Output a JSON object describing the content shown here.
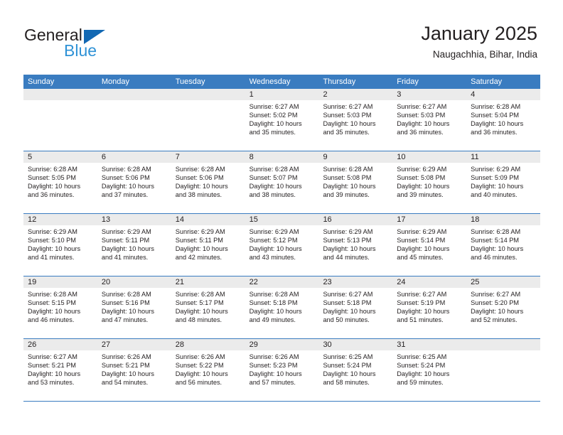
{
  "brand": {
    "name_part1": "General",
    "name_part2": "Blue",
    "accent_color": "#2f92d6",
    "triangle_color": "#1268b3"
  },
  "header": {
    "title": "January 2025",
    "subtitle": "Naugachhia, Bihar, India"
  },
  "calendar": {
    "header_bg": "#3a7cc0",
    "datecell_bg": "#ebebeb",
    "weekdays": [
      "Sunday",
      "Monday",
      "Tuesday",
      "Wednesday",
      "Thursday",
      "Friday",
      "Saturday"
    ],
    "weeks": [
      [
        {
          "day": "",
          "empty": true
        },
        {
          "day": "",
          "empty": true
        },
        {
          "day": "",
          "empty": true
        },
        {
          "day": "1",
          "sunrise": "Sunrise: 6:27 AM",
          "sunset": "Sunset: 5:02 PM",
          "daylight_line1": "Daylight: 10 hours",
          "daylight_line2": "and 35 minutes."
        },
        {
          "day": "2",
          "sunrise": "Sunrise: 6:27 AM",
          "sunset": "Sunset: 5:03 PM",
          "daylight_line1": "Daylight: 10 hours",
          "daylight_line2": "and 35 minutes."
        },
        {
          "day": "3",
          "sunrise": "Sunrise: 6:27 AM",
          "sunset": "Sunset: 5:03 PM",
          "daylight_line1": "Daylight: 10 hours",
          "daylight_line2": "and 36 minutes."
        },
        {
          "day": "4",
          "sunrise": "Sunrise: 6:28 AM",
          "sunset": "Sunset: 5:04 PM",
          "daylight_line1": "Daylight: 10 hours",
          "daylight_line2": "and 36 minutes."
        }
      ],
      [
        {
          "day": "5",
          "sunrise": "Sunrise: 6:28 AM",
          "sunset": "Sunset: 5:05 PM",
          "daylight_line1": "Daylight: 10 hours",
          "daylight_line2": "and 36 minutes."
        },
        {
          "day": "6",
          "sunrise": "Sunrise: 6:28 AM",
          "sunset": "Sunset: 5:06 PM",
          "daylight_line1": "Daylight: 10 hours",
          "daylight_line2": "and 37 minutes."
        },
        {
          "day": "7",
          "sunrise": "Sunrise: 6:28 AM",
          "sunset": "Sunset: 5:06 PM",
          "daylight_line1": "Daylight: 10 hours",
          "daylight_line2": "and 38 minutes."
        },
        {
          "day": "8",
          "sunrise": "Sunrise: 6:28 AM",
          "sunset": "Sunset: 5:07 PM",
          "daylight_line1": "Daylight: 10 hours",
          "daylight_line2": "and 38 minutes."
        },
        {
          "day": "9",
          "sunrise": "Sunrise: 6:28 AM",
          "sunset": "Sunset: 5:08 PM",
          "daylight_line1": "Daylight: 10 hours",
          "daylight_line2": "and 39 minutes."
        },
        {
          "day": "10",
          "sunrise": "Sunrise: 6:29 AM",
          "sunset": "Sunset: 5:08 PM",
          "daylight_line1": "Daylight: 10 hours",
          "daylight_line2": "and 39 minutes."
        },
        {
          "day": "11",
          "sunrise": "Sunrise: 6:29 AM",
          "sunset": "Sunset: 5:09 PM",
          "daylight_line1": "Daylight: 10 hours",
          "daylight_line2": "and 40 minutes."
        }
      ],
      [
        {
          "day": "12",
          "sunrise": "Sunrise: 6:29 AM",
          "sunset": "Sunset: 5:10 PM",
          "daylight_line1": "Daylight: 10 hours",
          "daylight_line2": "and 41 minutes."
        },
        {
          "day": "13",
          "sunrise": "Sunrise: 6:29 AM",
          "sunset": "Sunset: 5:11 PM",
          "daylight_line1": "Daylight: 10 hours",
          "daylight_line2": "and 41 minutes."
        },
        {
          "day": "14",
          "sunrise": "Sunrise: 6:29 AM",
          "sunset": "Sunset: 5:11 PM",
          "daylight_line1": "Daylight: 10 hours",
          "daylight_line2": "and 42 minutes."
        },
        {
          "day": "15",
          "sunrise": "Sunrise: 6:29 AM",
          "sunset": "Sunset: 5:12 PM",
          "daylight_line1": "Daylight: 10 hours",
          "daylight_line2": "and 43 minutes."
        },
        {
          "day": "16",
          "sunrise": "Sunrise: 6:29 AM",
          "sunset": "Sunset: 5:13 PM",
          "daylight_line1": "Daylight: 10 hours",
          "daylight_line2": "and 44 minutes."
        },
        {
          "day": "17",
          "sunrise": "Sunrise: 6:29 AM",
          "sunset": "Sunset: 5:14 PM",
          "daylight_line1": "Daylight: 10 hours",
          "daylight_line2": "and 45 minutes."
        },
        {
          "day": "18",
          "sunrise": "Sunrise: 6:28 AM",
          "sunset": "Sunset: 5:14 PM",
          "daylight_line1": "Daylight: 10 hours",
          "daylight_line2": "and 46 minutes."
        }
      ],
      [
        {
          "day": "19",
          "sunrise": "Sunrise: 6:28 AM",
          "sunset": "Sunset: 5:15 PM",
          "daylight_line1": "Daylight: 10 hours",
          "daylight_line2": "and 46 minutes."
        },
        {
          "day": "20",
          "sunrise": "Sunrise: 6:28 AM",
          "sunset": "Sunset: 5:16 PM",
          "daylight_line1": "Daylight: 10 hours",
          "daylight_line2": "and 47 minutes."
        },
        {
          "day": "21",
          "sunrise": "Sunrise: 6:28 AM",
          "sunset": "Sunset: 5:17 PM",
          "daylight_line1": "Daylight: 10 hours",
          "daylight_line2": "and 48 minutes."
        },
        {
          "day": "22",
          "sunrise": "Sunrise: 6:28 AM",
          "sunset": "Sunset: 5:18 PM",
          "daylight_line1": "Daylight: 10 hours",
          "daylight_line2": "and 49 minutes."
        },
        {
          "day": "23",
          "sunrise": "Sunrise: 6:27 AM",
          "sunset": "Sunset: 5:18 PM",
          "daylight_line1": "Daylight: 10 hours",
          "daylight_line2": "and 50 minutes."
        },
        {
          "day": "24",
          "sunrise": "Sunrise: 6:27 AM",
          "sunset": "Sunset: 5:19 PM",
          "daylight_line1": "Daylight: 10 hours",
          "daylight_line2": "and 51 minutes."
        },
        {
          "day": "25",
          "sunrise": "Sunrise: 6:27 AM",
          "sunset": "Sunset: 5:20 PM",
          "daylight_line1": "Daylight: 10 hours",
          "daylight_line2": "and 52 minutes."
        }
      ],
      [
        {
          "day": "26",
          "sunrise": "Sunrise: 6:27 AM",
          "sunset": "Sunset: 5:21 PM",
          "daylight_line1": "Daylight: 10 hours",
          "daylight_line2": "and 53 minutes."
        },
        {
          "day": "27",
          "sunrise": "Sunrise: 6:26 AM",
          "sunset": "Sunset: 5:21 PM",
          "daylight_line1": "Daylight: 10 hours",
          "daylight_line2": "and 54 minutes."
        },
        {
          "day": "28",
          "sunrise": "Sunrise: 6:26 AM",
          "sunset": "Sunset: 5:22 PM",
          "daylight_line1": "Daylight: 10 hours",
          "daylight_line2": "and 56 minutes."
        },
        {
          "day": "29",
          "sunrise": "Sunrise: 6:26 AM",
          "sunset": "Sunset: 5:23 PM",
          "daylight_line1": "Daylight: 10 hours",
          "daylight_line2": "and 57 minutes."
        },
        {
          "day": "30",
          "sunrise": "Sunrise: 6:25 AM",
          "sunset": "Sunset: 5:24 PM",
          "daylight_line1": "Daylight: 10 hours",
          "daylight_line2": "and 58 minutes."
        },
        {
          "day": "31",
          "sunrise": "Sunrise: 6:25 AM",
          "sunset": "Sunset: 5:24 PM",
          "daylight_line1": "Daylight: 10 hours",
          "daylight_line2": "and 59 minutes."
        },
        {
          "day": "",
          "empty": true
        }
      ]
    ]
  }
}
